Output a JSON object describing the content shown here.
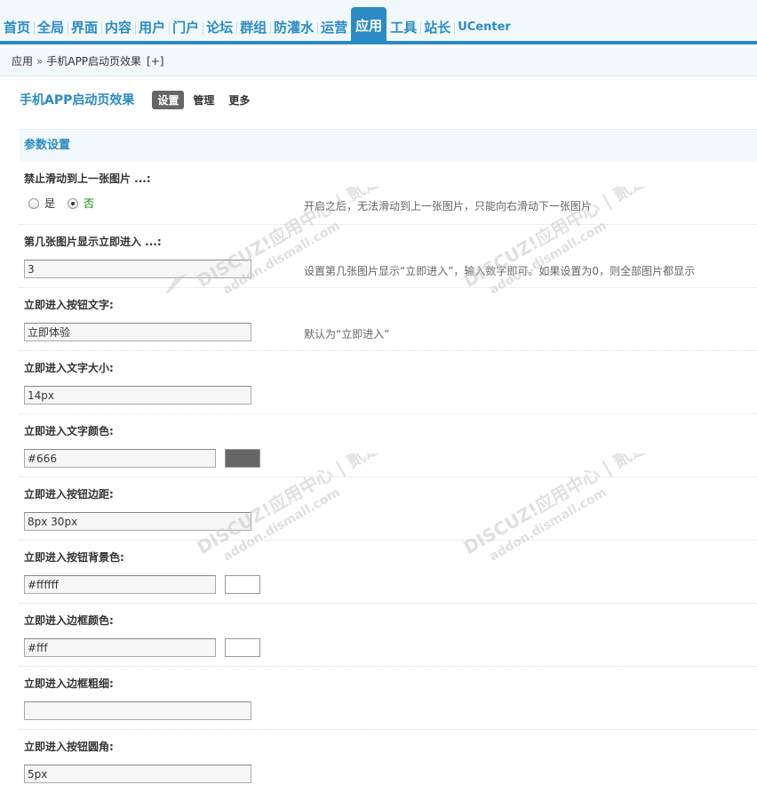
{
  "topnav": {
    "tabs": [
      {
        "label": "首页"
      },
      {
        "label": "全局"
      },
      {
        "label": "界面"
      },
      {
        "label": "内容"
      },
      {
        "label": "用户"
      },
      {
        "label": "门户"
      },
      {
        "label": "论坛"
      },
      {
        "label": "群组"
      },
      {
        "label": "防灌水"
      },
      {
        "label": "运营"
      },
      {
        "label": "应用"
      },
      {
        "label": "工具"
      },
      {
        "label": "站长"
      },
      {
        "label": "UCenter"
      }
    ],
    "active_index": 10
  },
  "breadcrumb": {
    "root": "应用",
    "separator": "»",
    "current": "手机APP启动页效果",
    "add": "[+]"
  },
  "page": {
    "title": "手机APP启动页效果",
    "subtabs": [
      "设置",
      "管理",
      "更多"
    ]
  },
  "section": {
    "title": "参数设置"
  },
  "settings": [
    {
      "label": "禁止滑动到上一张图片 ...:",
      "type": "radio",
      "options": [
        "是",
        "否"
      ],
      "selected": "否",
      "comment": "开启之后，无法滑动到上一张图片，只能向右滑动下一张图片"
    },
    {
      "label": "第几张图片显示立即进入 ...:",
      "type": "text",
      "value": "3",
      "comment": "设置第几张图片显示“立即进入”，输入数字即可。如果设置为0，则全部图片都显示"
    },
    {
      "label": "立即进入按钮文字:",
      "type": "text",
      "value": "立即体验",
      "comment": "默认为“立即进入”"
    },
    {
      "label": "立即进入文字大小:",
      "type": "text",
      "value": "14px",
      "comment": ""
    },
    {
      "label": "立即进入文字颜色:",
      "type": "color",
      "value": "#666",
      "comment": ""
    },
    {
      "label": "立即进入按钮边距:",
      "type": "text",
      "value": "8px 30px",
      "comment": ""
    },
    {
      "label": "立即进入按钮背景色:",
      "type": "color",
      "value": "#ffffff",
      "comment": ""
    },
    {
      "label": "立即进入边框颜色:",
      "type": "color",
      "value": "#fff",
      "comment": ""
    },
    {
      "label": "立即进入边框粗细:",
      "type": "text",
      "value": "",
      "comment": ""
    },
    {
      "label": "立即进入按钮圆角:",
      "type": "text",
      "value": "5px",
      "comment": ""
    }
  ],
  "colors": {
    "accent": "#2b8bc4",
    "nav_bg": "#f2f9fd",
    "text_color_swatch": "#666666",
    "bg_color_swatch": "#ffffff",
    "border_color_swatch": "#ffffff"
  },
  "watermark": {
    "line1": "DISCUZ!应用中心",
    "line2": "addon.dismall.com",
    "mark": "贰道"
  }
}
